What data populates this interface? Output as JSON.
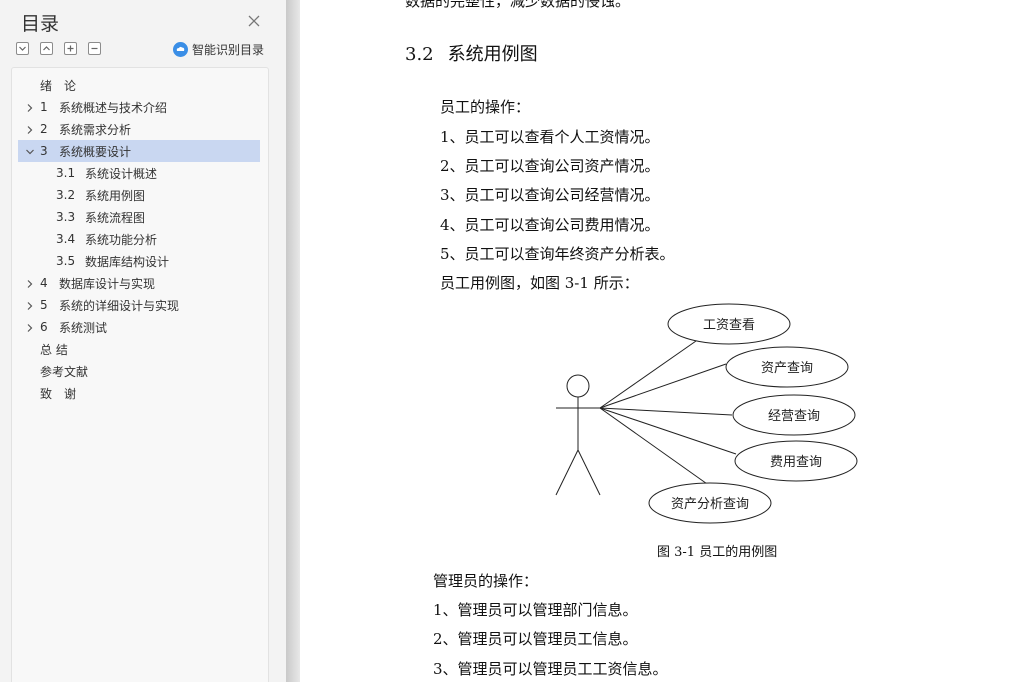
{
  "toc": {
    "title": "目录",
    "ai_button_label": "智能识别目录",
    "items": [
      {
        "num": "",
        "label": "绪　论",
        "level": 0,
        "chevron": "none"
      },
      {
        "num": "1",
        "label": "系统概述与技术介绍",
        "level": 0,
        "chevron": "right"
      },
      {
        "num": "2",
        "label": "系统需求分析",
        "level": 0,
        "chevron": "right"
      },
      {
        "num": "3",
        "label": "系统概要设计",
        "level": 0,
        "chevron": "down",
        "selected": true
      },
      {
        "num": "3.1",
        "label": "系统设计概述",
        "level": 1,
        "chevron": "none"
      },
      {
        "num": "3.2",
        "label": "系统用例图",
        "level": 1,
        "chevron": "none"
      },
      {
        "num": "3.3",
        "label": "系统流程图",
        "level": 1,
        "chevron": "none"
      },
      {
        "num": "3.4",
        "label": "系统功能分析",
        "level": 1,
        "chevron": "none"
      },
      {
        "num": "3.5",
        "label": "数据库结构设计",
        "level": 1,
        "chevron": "none"
      },
      {
        "num": "4",
        "label": "数据库设计与实现",
        "level": 0,
        "chevron": "right"
      },
      {
        "num": "5",
        "label": "系统的详细设计与实现",
        "level": 0,
        "chevron": "right"
      },
      {
        "num": "6",
        "label": "系统测试",
        "level": 0,
        "chevron": "right"
      },
      {
        "num": "",
        "label": "总 结",
        "level": 0,
        "chevron": "none"
      },
      {
        "num": "",
        "label": "参考文献",
        "level": 0,
        "chevron": "none"
      },
      {
        "num": "",
        "label": "致　谢",
        "level": 0,
        "chevron": "none"
      }
    ]
  },
  "doc": {
    "top_partial": "数据的完整性，减少数据的侵蚀。",
    "heading_num": "3.2",
    "heading_text": "系统用例图",
    "employee_intro": "员工的操作：",
    "employee_ops": [
      "1、员工可以查看个人工资情况。",
      "2、员工可以查询公司资产情况。",
      "3、员工可以查询公司经营情况。",
      "4、员工可以查询公司费用情况。",
      "5、员工可以查询年终资产分析表。"
    ],
    "figure_ref": "员工用例图，如图 3-1 所示：",
    "use_cases": [
      "工资查看",
      "资产查询",
      "经营查询",
      "费用查询",
      "资产分析查询"
    ],
    "figure_caption": "图 3-1 员工的用例图",
    "admin_intro": "管理员的操作：",
    "admin_ops": [
      "1、管理员可以管理部门信息。",
      "2、管理员可以管理员工信息。",
      "3、管理员可以管理员工工资信息。"
    ]
  },
  "colors": {
    "selected_row": "#c9d7f1",
    "ai_icon": "#3a8ee6",
    "sidebar_bg": "#f3f3f3",
    "page_bg": "#ffffff"
  }
}
